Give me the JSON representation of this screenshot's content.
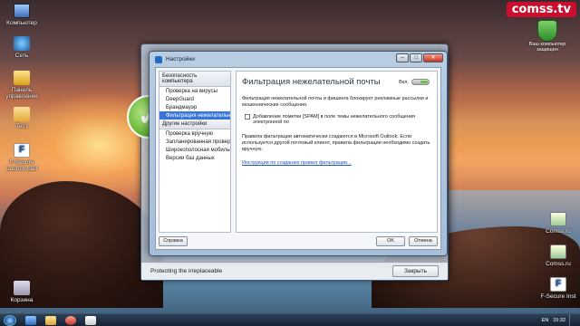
{
  "desktop": {
    "icons_left": [
      {
        "label": "Компьютер",
        "icon": "computer-icon"
      },
      {
        "label": "Сеть",
        "icon": "network-icon"
      },
      {
        "label": "Панель управления",
        "icon": "control-panel-icon"
      },
      {
        "label": "Тест",
        "icon": "folder-icon"
      },
      {
        "label": "F-Secure Launch pad",
        "icon": "f-secure-icon"
      },
      {
        "label": "Корзина",
        "icon": "recycle-bin-icon"
      }
    ],
    "icons_right": [
      {
        "label": "Comss.ru",
        "icon": "winrar-icon"
      },
      {
        "label": "Comss.ru",
        "icon": "winrar-icon"
      },
      {
        "label": "F-Secure Inst",
        "icon": "f-secure-icon"
      }
    ],
    "watermark": "comss.tv",
    "gadget_label": "Ваш компьютер защищен"
  },
  "background_window": {
    "status_text": "Protecting the irreplaceable",
    "close_label": "Закрыть"
  },
  "dialog": {
    "title": "Настройки",
    "sidebar": {
      "groups": [
        {
          "label": "Безопасность компьютера",
          "items": [
            {
              "label": "Проверка на вирусы",
              "selected": false
            },
            {
              "label": "DeepGuard",
              "selected": false
            },
            {
              "label": "Брандмауэр",
              "selected": false
            },
            {
              "label": "Фильтрация нежелательных...",
              "selected": true
            }
          ]
        },
        {
          "label": "Другие настройки",
          "items": [
            {
              "label": "Проверка вручную",
              "selected": false
            },
            {
              "label": "Запланированная проверка",
              "selected": false
            },
            {
              "label": "Широкополосная мобильн...",
              "selected": false
            },
            {
              "label": "Версии баз данных",
              "selected": false
            }
          ]
        }
      ]
    },
    "main": {
      "title": "Фильтрация нежелательной почты",
      "toggle_label": "Вкл.",
      "toggle_on": true,
      "description": "Фильтрация нежелательной почты и фишинга блокирует рекламные рассылки и мошеннические сообщения.",
      "checkbox_label": "Добавление пометки [SPAM] в поле темы нежелательного сообщения электронной по",
      "checkbox_checked": false,
      "info_text": "Правила фильтрации автоматически создаются в Microsoft Outlook. Если используется другой почтовый клиент, правила фильтрации необходимо создать вручную.",
      "link_text": "Инструкции по созданию правил фильтрации..."
    },
    "buttons": {
      "help": "Справка",
      "ok": "OK",
      "cancel": "Отмена"
    }
  },
  "taskbar": {
    "language": "EN",
    "time": "15:32"
  }
}
